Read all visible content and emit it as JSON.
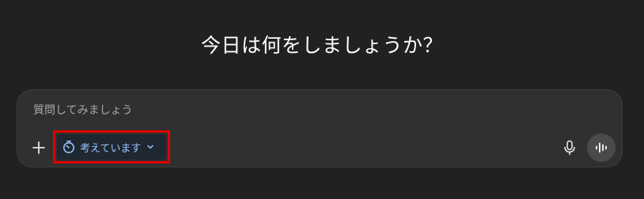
{
  "main": {
    "heading": "今日は何をしましょうか？"
  },
  "composer": {
    "placeholder": "質問してみましょう",
    "mode_label": "考えています",
    "icons": {
      "add": "plus-icon",
      "mode": "timer-icon",
      "mode_dropdown": "chevron-down-icon",
      "mic": "microphone-icon",
      "voice": "voice-waveform-icon"
    }
  },
  "colors": {
    "background": "#212121",
    "composer_background": "#303030",
    "mode_accent": "#99c4ff",
    "highlight_border": "#e00000"
  }
}
